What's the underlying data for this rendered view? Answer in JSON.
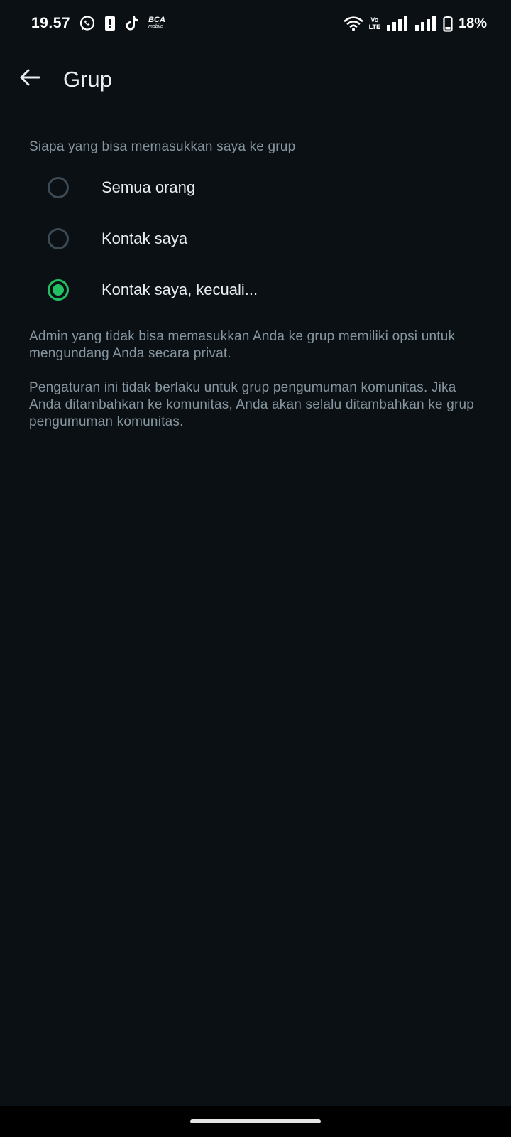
{
  "status_bar": {
    "time": "19.57",
    "battery_percent": "18%",
    "volte_top": "Vo",
    "volte_bottom": "LTE",
    "bca_brand": "BCA",
    "bca_sub": "mobile",
    "icons": [
      "whatsapp-icon",
      "alert-icon",
      "tiktok-icon",
      "bca-mobile-icon",
      "wifi-icon",
      "volte-icon",
      "signal-icon",
      "signal-icon",
      "battery-icon"
    ]
  },
  "header": {
    "title": "Grup"
  },
  "section": {
    "label": "Siapa yang bisa memasukkan saya ke grup"
  },
  "options": [
    {
      "label": "Semua orang",
      "selected": false
    },
    {
      "label": "Kontak saya",
      "selected": false
    },
    {
      "label": "Kontak saya, kecuali...",
      "selected": true
    }
  ],
  "info": {
    "paragraph1": "Admin yang tidak bisa memasukkan Anda ke grup memiliki opsi untuk mengundang Anda secara privat.",
    "paragraph2": "Pengaturan ini tidak berlaku untuk grup pengumuman komunitas. Jika Anda ditambahkan ke komunitas, Anda akan selalu ditambahkan ke grup pengumuman komunitas."
  },
  "colors": {
    "background": "#0b1014",
    "accent": "#21c063",
    "secondary_text": "#8696a0",
    "primary_text": "#e9edef"
  }
}
